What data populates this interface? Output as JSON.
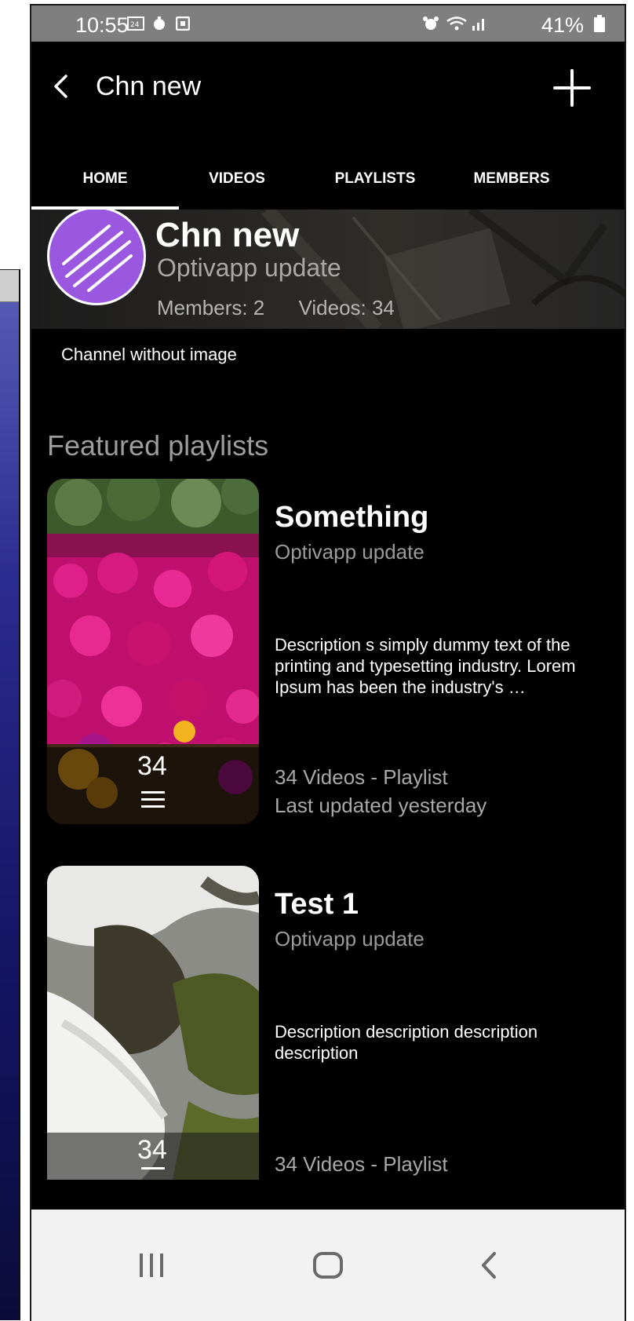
{
  "status_bar": {
    "time": "10:55",
    "battery": "41%"
  },
  "app_bar": {
    "title": "Chn new"
  },
  "tabs": [
    {
      "label": "HOME",
      "selected": true
    },
    {
      "label": "VIDEOS",
      "selected": false
    },
    {
      "label": "PLAYLISTS",
      "selected": false
    },
    {
      "label": "MEMBERS",
      "selected": false
    }
  ],
  "channel": {
    "name": "Chn new",
    "subtitle": "Optivapp update",
    "members": "Members: 2",
    "videos": "Videos: 34",
    "description": "Channel without image",
    "avatar_color": "#9a57e0"
  },
  "featured": {
    "title": "Featured playlists",
    "playlists": [
      {
        "name": "Something",
        "author": "Optivapp update",
        "description": "Description s simply dummy text of the printing and typesetting industry. Lorem Ipsum has been the industry's …",
        "count": "34",
        "meta1": "34 Videos - Playlist",
        "meta2": "Last updated yesterday"
      },
      {
        "name": "Test 1",
        "author": "Optivapp update",
        "description": "Description description description description",
        "count": "34",
        "meta1": "34 Videos - Playlist"
      }
    ]
  },
  "colors": {
    "background": "#000000",
    "status_bar": "#7f7f7f",
    "tab_indicator": "#ffffff",
    "nav_bar": "#f2f2f2"
  },
  "icons": {
    "back": "chevron-left-icon",
    "add": "plus-icon",
    "playlist": "list-icon",
    "nav_recents": "recents-icon",
    "nav_home": "home-icon",
    "nav_back": "back-icon"
  }
}
